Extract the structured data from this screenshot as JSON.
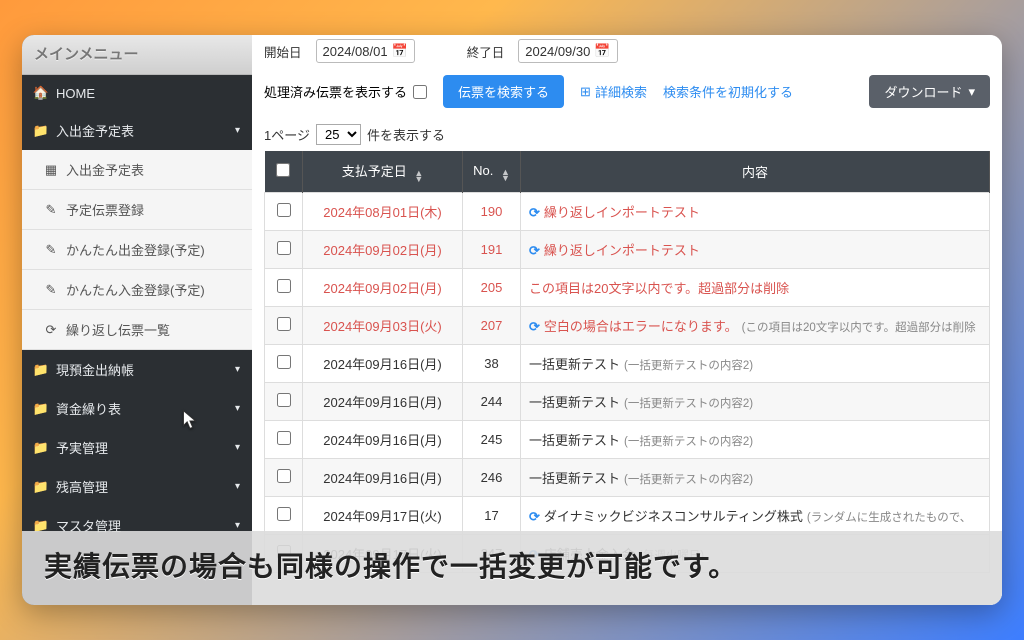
{
  "sidebar": {
    "title": "メインメニュー",
    "home": "HOME",
    "schedule": {
      "label": "入出金予定表",
      "subs": [
        "入出金予定表",
        "予定伝票登録",
        "かんたん出金登録(予定)",
        "かんたん入金登録(予定)",
        "繰り返し伝票一覧"
      ]
    },
    "cashbook": "現預金出納帳",
    "funding": "資金繰り表",
    "forecast": "予実管理",
    "balance": "残高管理",
    "master": "マスタ管理"
  },
  "filters": {
    "start_label": "開始日",
    "start_value": "2024/08/01",
    "end_label": "終了日",
    "end_value": "2024/09/30",
    "processed_label": "処理済み伝票を表示する",
    "search_btn": "伝票を検索する",
    "detail_link": "詳細検索",
    "reset_link": "検索条件を初期化する",
    "download_btn": "ダウンロード"
  },
  "paging": {
    "prefix": "1ページ",
    "count": "25",
    "suffix": "件を表示する"
  },
  "columns": {
    "date": "支払予定日",
    "no": "No.",
    "content": "内容"
  },
  "rows": [
    {
      "date": "2024年08月01日(木)",
      "no": "190",
      "red": true,
      "repeat": true,
      "content": "繰り返しインポートテスト",
      "note": ""
    },
    {
      "date": "2024年09月02日(月)",
      "no": "191",
      "red": true,
      "repeat": true,
      "content": "繰り返しインポートテスト",
      "note": ""
    },
    {
      "date": "2024年09月02日(月)",
      "no": "205",
      "red": true,
      "repeat": false,
      "content": "この項目は20文字以内です。超過部分は削除",
      "note": ""
    },
    {
      "date": "2024年09月03日(火)",
      "no": "207",
      "red": true,
      "repeat": true,
      "content": "空白の場合はエラーになります。",
      "note": "(この項目は20文字以内です。超過部分は削除"
    },
    {
      "date": "2024年09月16日(月)",
      "no": "38",
      "red": false,
      "repeat": false,
      "content": "一括更新テスト",
      "note": "(一括更新テストの内容2)"
    },
    {
      "date": "2024年09月16日(月)",
      "no": "244",
      "red": false,
      "repeat": false,
      "content": "一括更新テスト",
      "note": "(一括更新テストの内容2)"
    },
    {
      "date": "2024年09月16日(月)",
      "no": "245",
      "red": false,
      "repeat": false,
      "content": "一括更新テスト",
      "note": "(一括更新テストの内容2)"
    },
    {
      "date": "2024年09月16日(月)",
      "no": "246",
      "red": false,
      "repeat": false,
      "content": "一括更新テスト",
      "note": "(一括更新テストの内容2)"
    },
    {
      "date": "2024年09月17日(火)",
      "no": "17",
      "red": false,
      "repeat": true,
      "content": "ダイナミックビジネスコンサルティング株式",
      "note": "(ランダムに生成されたもので、"
    },
    {
      "date": "2024年09月17日(火)",
      "no": "247",
      "red": false,
      "repeat": true,
      "content": "店舗売上金入金",
      "note": "(毎週火曜日)"
    }
  ],
  "caption": "実績伝票の場合も同様の操作で一括変更が可能です。"
}
